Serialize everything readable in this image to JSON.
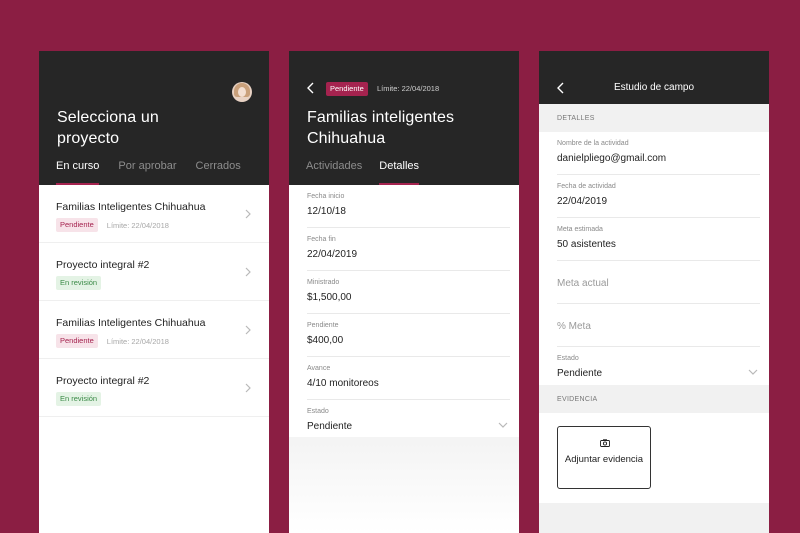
{
  "screen1": {
    "title": "Selecciona un proyecto",
    "tabs": [
      {
        "label": "En curso"
      },
      {
        "label": "Por aprobar"
      },
      {
        "label": "Cerrados"
      }
    ],
    "items": [
      {
        "title": "Familias Inteligentes Chihuahua",
        "badge": "Pendiente",
        "limit": "Límite: 22/04/2018"
      },
      {
        "title": "Proyecto integral #2",
        "badge": "En revisión",
        "limit": ""
      },
      {
        "title": "Familias Inteligentes Chihuahua",
        "badge": "Pendiente",
        "limit": "Límite: 22/04/2018"
      },
      {
        "title": "Proyecto integral #2",
        "badge": "En revisión",
        "limit": ""
      }
    ]
  },
  "screen2": {
    "badge": "Pendiente",
    "limit": "Límite: 22/04/2018",
    "title": "Familias inteligentes Chihuahua",
    "tabs": [
      {
        "label": "Actividades"
      },
      {
        "label": "Detalles"
      }
    ],
    "fields": [
      {
        "label": "Fecha inicio",
        "value": "12/10/18"
      },
      {
        "label": "Fecha fin",
        "value": "22/04/2019"
      },
      {
        "label": "Ministrado",
        "value": "$1,500,00"
      },
      {
        "label": "Pendiente",
        "value": "$400,00"
      },
      {
        "label": "Avance",
        "value": "4/10 monitoreos"
      },
      {
        "label": "Estado",
        "value": "Pendiente"
      }
    ]
  },
  "screen3": {
    "title": "Estudio de campo",
    "section_details": "DETALLES",
    "fields": [
      {
        "label": "Nombre de la actividad",
        "value": "danielpliego@gmail.com"
      },
      {
        "label": "Fecha de actividad",
        "value": "22/04/2019"
      },
      {
        "label": "Meta estimada",
        "value": "50 asistentes"
      }
    ],
    "placeholders": {
      "meta_actual": "Meta actual",
      "pct_meta": "% Meta"
    },
    "estado": {
      "label": "Estado",
      "value": "Pendiente"
    },
    "section_evidence": "EVIDENCIA",
    "attach_label": "Adjuntar evidencia"
  },
  "colors": {
    "background": "#8b1e43",
    "header": "#262626",
    "accent": "#a5234f",
    "review_green": "#3a8a46"
  },
  "icons": [
    "chevron-right-icon",
    "chevron-left-icon",
    "chevron-down-icon",
    "camera-icon",
    "avatar"
  ]
}
